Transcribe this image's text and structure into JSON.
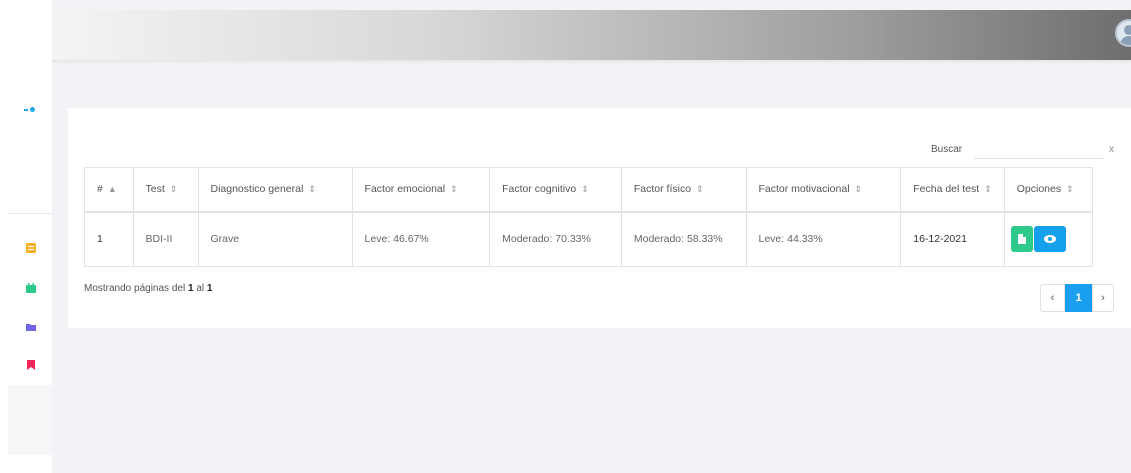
{
  "sidebar": {
    "icons": [
      {
        "name": "list-icon",
        "color": "#f8b324"
      },
      {
        "name": "calendar-icon",
        "color": "#2dca8c"
      },
      {
        "name": "folder-icon",
        "color": "#7064e8"
      },
      {
        "name": "bookmark-icon",
        "color": "#f0285a"
      }
    ]
  },
  "search": {
    "label": "Buscar",
    "value": "",
    "clear": "x"
  },
  "table": {
    "headers": [
      "#",
      "Test",
      "Diagnostico general",
      "Factor emocional",
      "Factor cognitivo",
      "Factor físico",
      "Factor motivacional",
      "Fecha del test",
      "Opciones"
    ],
    "rows": [
      {
        "num": "1",
        "test": "BDI-II",
        "diagnostico": "Grave",
        "emocional": "Leve: 46.67%",
        "cognitivo": "Moderado: 70.33%",
        "fisico": "Moderado: 58.33%",
        "motivacional": "Leve: 44.33%",
        "fecha": "16-12-2021"
      }
    ]
  },
  "info": {
    "prefix": "Mostrando páginas del",
    "from": "1",
    "mid": "al",
    "to": "1"
  },
  "pager": {
    "prev": "‹",
    "current": "1",
    "next": "›"
  },
  "colors": {
    "accent": "#1a9ff0",
    "success": "#2dca8c"
  }
}
